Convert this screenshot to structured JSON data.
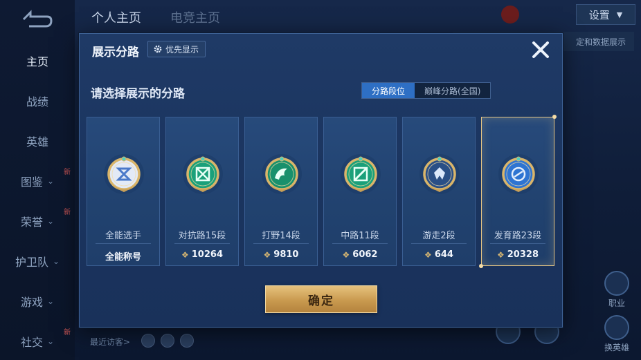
{
  "background": {
    "top_tabs": [
      "个人主页",
      "电竞主页"
    ],
    "settings_label": "设置",
    "promo_text": "定和数据展示",
    "sidebar": [
      {
        "label": "主页",
        "new": false,
        "chevron": false,
        "active": true
      },
      {
        "label": "战绩",
        "new": false,
        "chevron": false,
        "active": false
      },
      {
        "label": "英雄",
        "new": false,
        "chevron": false,
        "active": false
      },
      {
        "label": "图鉴",
        "new": true,
        "chevron": true,
        "active": false
      },
      {
        "label": "荣誉",
        "new": true,
        "chevron": true,
        "active": false
      },
      {
        "label": "护卫队",
        "new": false,
        "chevron": true,
        "active": false
      },
      {
        "label": "游戏",
        "new": false,
        "chevron": true,
        "active": false
      },
      {
        "label": "社交",
        "new": true,
        "chevron": true,
        "active": false
      }
    ],
    "new_tag": "新",
    "recent_visitors": "最近访客>",
    "right_floats": [
      "职业",
      "换英雄"
    ]
  },
  "dialog": {
    "title": "展示分路",
    "priority_label": "优先显示",
    "prompt": "请选择展示的分路",
    "segments": [
      {
        "label": "分路段位",
        "active": true
      },
      {
        "label": "巅峰分路(全国)",
        "active": false
      }
    ],
    "cards": [
      {
        "name": "全能选手",
        "score": "全能称号",
        "has_diamond": false,
        "emblem": "all-round",
        "selected": false
      },
      {
        "name": "对抗路15段",
        "score": "10264",
        "has_diamond": true,
        "emblem": "clash-lane",
        "selected": false
      },
      {
        "name": "打野14段",
        "score": "9810",
        "has_diamond": true,
        "emblem": "jungle",
        "selected": false
      },
      {
        "name": "中路11段",
        "score": "6062",
        "has_diamond": true,
        "emblem": "mid-lane",
        "selected": false
      },
      {
        "name": "游走2段",
        "score": "644",
        "has_diamond": true,
        "emblem": "roam",
        "selected": false
      },
      {
        "name": "发育路23段",
        "score": "20328",
        "has_diamond": true,
        "emblem": "farm-lane",
        "selected": true
      }
    ],
    "confirm_label": "确定"
  }
}
